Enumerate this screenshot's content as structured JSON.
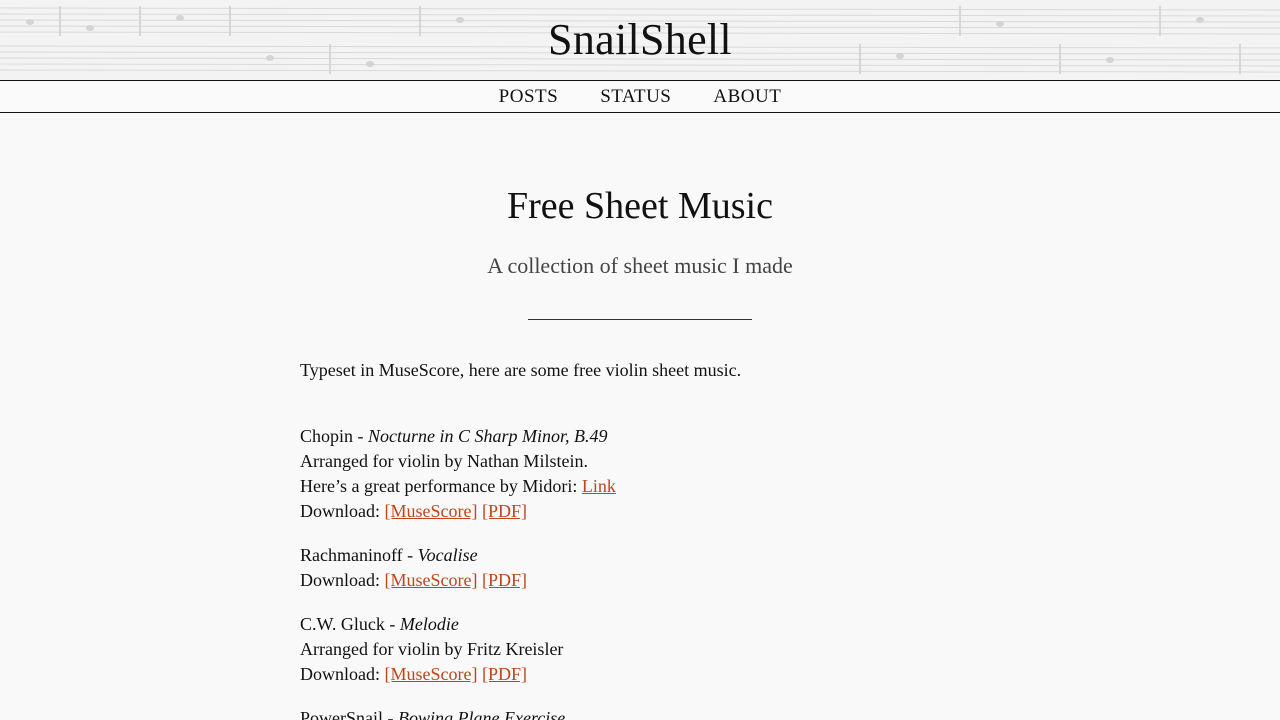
{
  "site": {
    "title": "SnailShell"
  },
  "nav": {
    "items": [
      "POSTS",
      "STATUS",
      "ABOUT"
    ]
  },
  "page": {
    "title": "Free Sheet Music",
    "subtitle": "A collection of sheet music I made",
    "intro": "Typeset in MuseScore, here are some free violin sheet music."
  },
  "pieces": [
    {
      "composer": "Chopin",
      "separator": " - ",
      "work": "Nocturne in C Sharp Minor, B.49",
      "arranged": "Arranged for violin by Nathan Milstein.",
      "performance_text": "Here’s a great performance by Midori: ",
      "performance_link": "Link",
      "download_label": "Download: ",
      "musescore_link": "[MuseScore]",
      "pdf_link": "[PDF]"
    },
    {
      "composer": "Rachmaninoff",
      "separator": " - ",
      "work": "Vocalise",
      "download_label": "Download: ",
      "musescore_link": "[MuseScore]",
      "pdf_link": "[PDF]"
    },
    {
      "composer": "C.W. Gluck",
      "separator": " - ",
      "work": "Melodie",
      "arranged": "Arranged for violin by Fritz Kreisler",
      "download_label": "Download: ",
      "musescore_link": "[MuseScore]",
      "pdf_link": "[PDF]"
    },
    {
      "composer": "PowerSnail",
      "separator": " - ",
      "work": "Bowing Plane Exercise"
    }
  ],
  "colors": {
    "link": "#c0451b",
    "background": "#f9f9f9",
    "text": "#111111"
  }
}
